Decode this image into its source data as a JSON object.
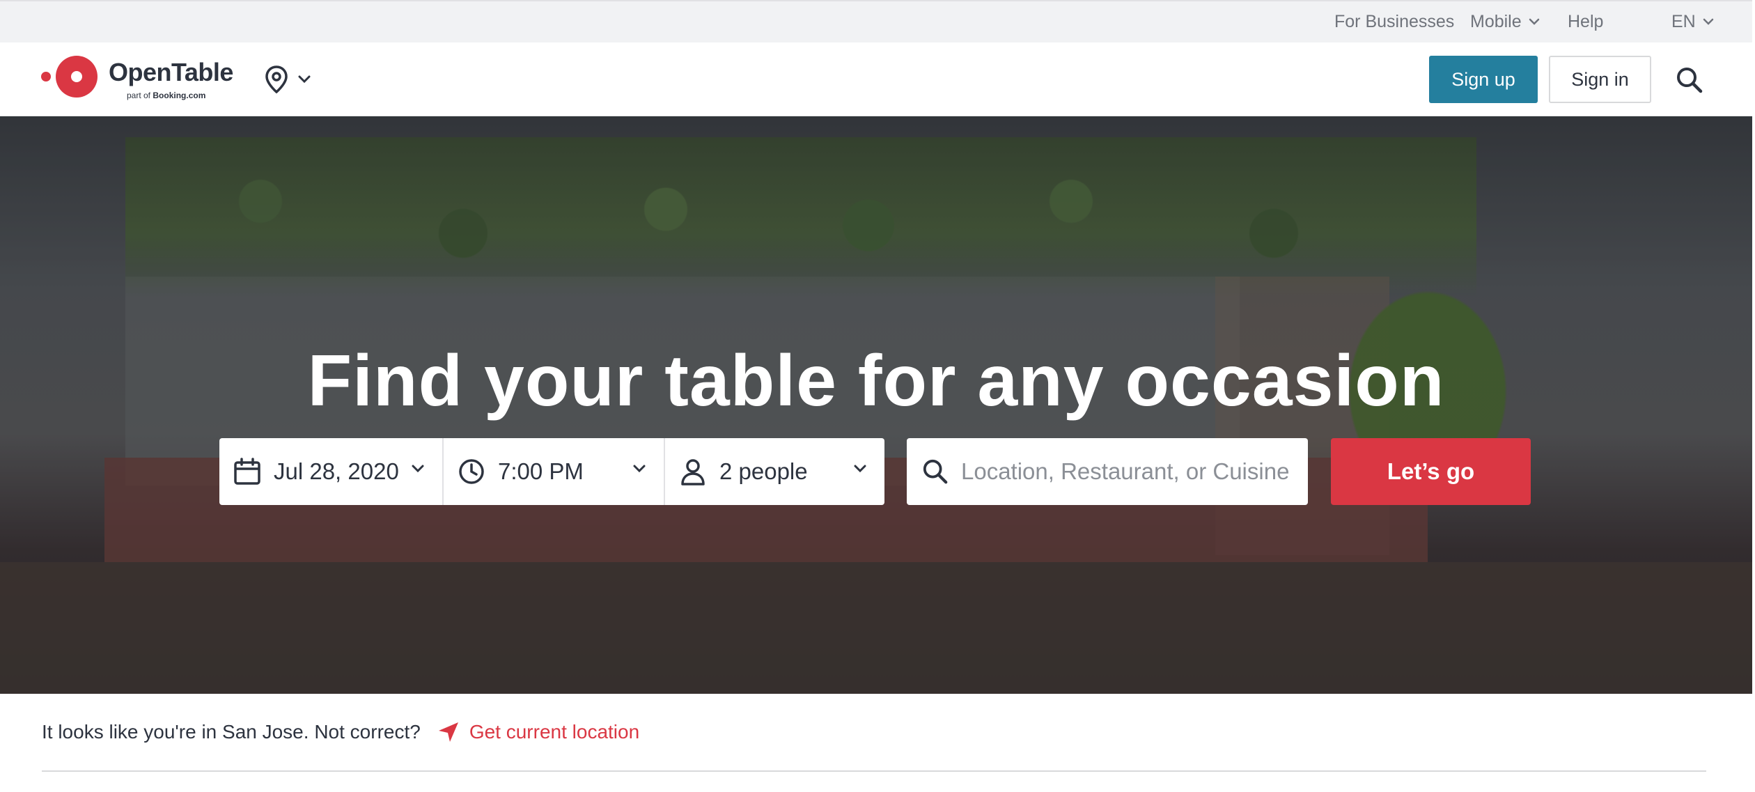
{
  "utility_bar": {
    "for_businesses": "For Businesses",
    "mobile": "Mobile",
    "help": "Help",
    "language": "EN"
  },
  "header": {
    "logo_text": "OpenTable",
    "logo_sub_prefix": "part of",
    "logo_sub_brand": "Booking.com",
    "sign_up": "Sign up",
    "sign_in": "Sign in"
  },
  "hero": {
    "title": "Find your table for any occasion",
    "date": "Jul 28, 2020",
    "time": "7:00 PM",
    "party": "2 people",
    "search_placeholder": "Location, Restaurant, or Cuisine",
    "go_button": "Let’s go"
  },
  "location": {
    "message": "It looks like you're in San Jose. Not correct?",
    "link": "Get current location"
  },
  "colors": {
    "brand_red": "#da3743",
    "signup_teal": "#247f9e",
    "text_dark": "#2d333f",
    "text_muted": "#6f737b"
  },
  "icons": [
    "location-pin-icon",
    "chevron-down-icon",
    "search-icon",
    "calendar-icon",
    "clock-icon",
    "person-icon",
    "navigation-arrow-icon"
  ]
}
